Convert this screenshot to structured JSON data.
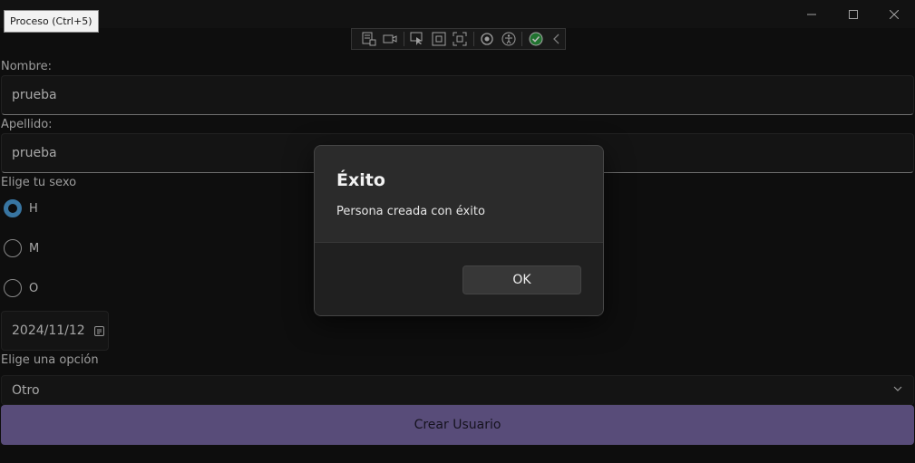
{
  "titlebar": {
    "tooltip": "Proceso (Ctrl+5)"
  },
  "devtoolbar": {
    "icons": [
      "live-visual-tree-icon",
      "video-camera-icon",
      "select-element-icon",
      "display-layout-adorners-icon",
      "track-focus-icon",
      "hot-reload-icon",
      "accessibility-icon",
      "check-circle-icon",
      "collapse-chevron-icon"
    ]
  },
  "form": {
    "nombre_label": "Nombre:",
    "nombre_value": "prueba",
    "apellido_label": "Apellido:",
    "apellido_value": "prueba",
    "sexo_label": "Elige tu sexo",
    "sexo_options": [
      "H",
      "M",
      "O"
    ],
    "sexo_selected": "H",
    "date_value": "2024/11/12",
    "opcion_label": "Elige una opción",
    "opcion_value": "Otro",
    "submit_label": "Crear Usuario"
  },
  "dialog": {
    "title": "Éxito",
    "message": "Persona creada con éxito",
    "ok_label": "OK"
  },
  "colors": {
    "accent": "#4ea3e0",
    "primary_button": "#7b6aa8",
    "background": "#141414"
  }
}
